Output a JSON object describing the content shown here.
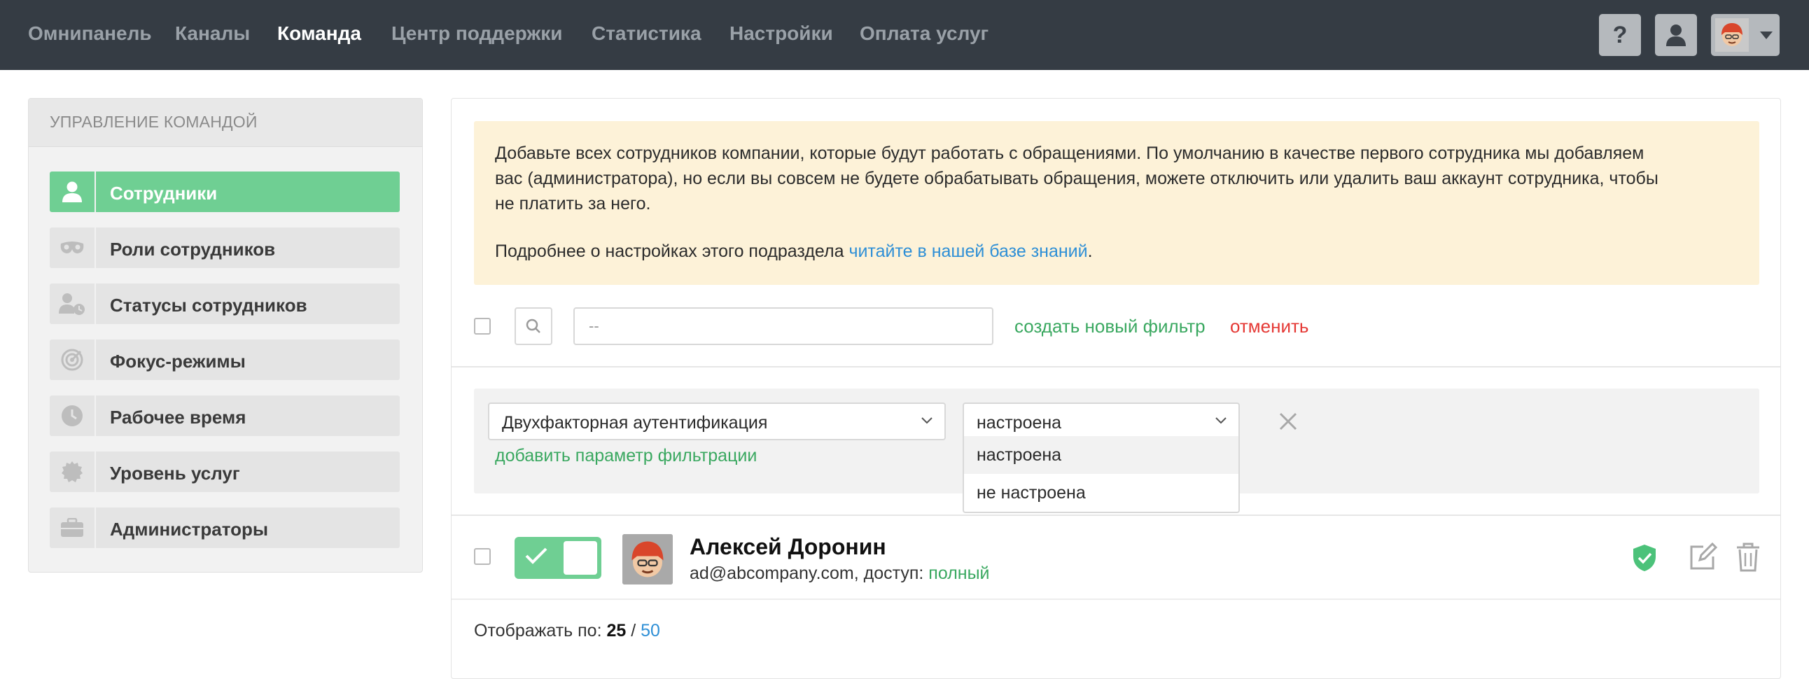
{
  "nav": {
    "items": [
      {
        "label": "Омнипанель",
        "active": false
      },
      {
        "label": "Каналы",
        "active": false
      },
      {
        "label": "Команда",
        "active": true
      },
      {
        "label": "Центр поддержки",
        "active": false
      },
      {
        "label": "Статистика",
        "active": false
      },
      {
        "label": "Настройки",
        "active": false
      },
      {
        "label": "Оплата услуг",
        "active": false
      }
    ],
    "help_label": "?"
  },
  "sidebar": {
    "title": "Управление командой",
    "items": [
      {
        "label": "Сотрудники",
        "icon": "user-icon",
        "active": true
      },
      {
        "label": "Роли сотрудников",
        "icon": "mask-icon",
        "active": false
      },
      {
        "label": "Статусы сотрудников",
        "icon": "user-clock-icon",
        "active": false
      },
      {
        "label": "Фокус-режимы",
        "icon": "target-icon",
        "active": false
      },
      {
        "label": "Рабочее время",
        "icon": "clock-icon",
        "active": false
      },
      {
        "label": "Уровень услуг",
        "icon": "badge-icon",
        "active": false
      },
      {
        "label": "Администраторы",
        "icon": "briefcase-icon",
        "active": false
      }
    ]
  },
  "notice": {
    "line1": "Добавьте всех сотрудников компании, которые будут работать с обращениями. По умолчанию в качестве первого сотрудника мы добавляем",
    "line2": "вас (администратора), но если вы совсем не будете обрабатывать обращения, можете отключить или удалить ваш аккаунт сотрудника, чтобы",
    "line3": "не платить за него.",
    "more_prefix": "Подробнее о настройках этого подраздела ",
    "more_link": "читайте в нашей базе знаний",
    "more_suffix": "."
  },
  "filter": {
    "input_value": "--",
    "create_label": "создать новый фильтр",
    "cancel_label": "отменить",
    "param_select": "Двухфакторная аутентификация",
    "value_select": "настроена",
    "options": [
      "настроена",
      "не настроена"
    ],
    "add_param_label": "добавить параметр фильтрации"
  },
  "employee": {
    "name": "Алексей Доронин",
    "email_access": "ad@abcompany.com, доступ: ",
    "access": "полный",
    "enabled": true
  },
  "pager": {
    "prefix": "Отображать по: ",
    "current": "25",
    "sep": " / ",
    "other": "50"
  },
  "colors": {
    "topbar": "#353c44",
    "accent_green": "#6fcf93",
    "link_green": "#3aa860",
    "link_blue": "#2e8fd6",
    "cancel_red": "#e53935",
    "notice_bg": "#fdf2d8"
  }
}
